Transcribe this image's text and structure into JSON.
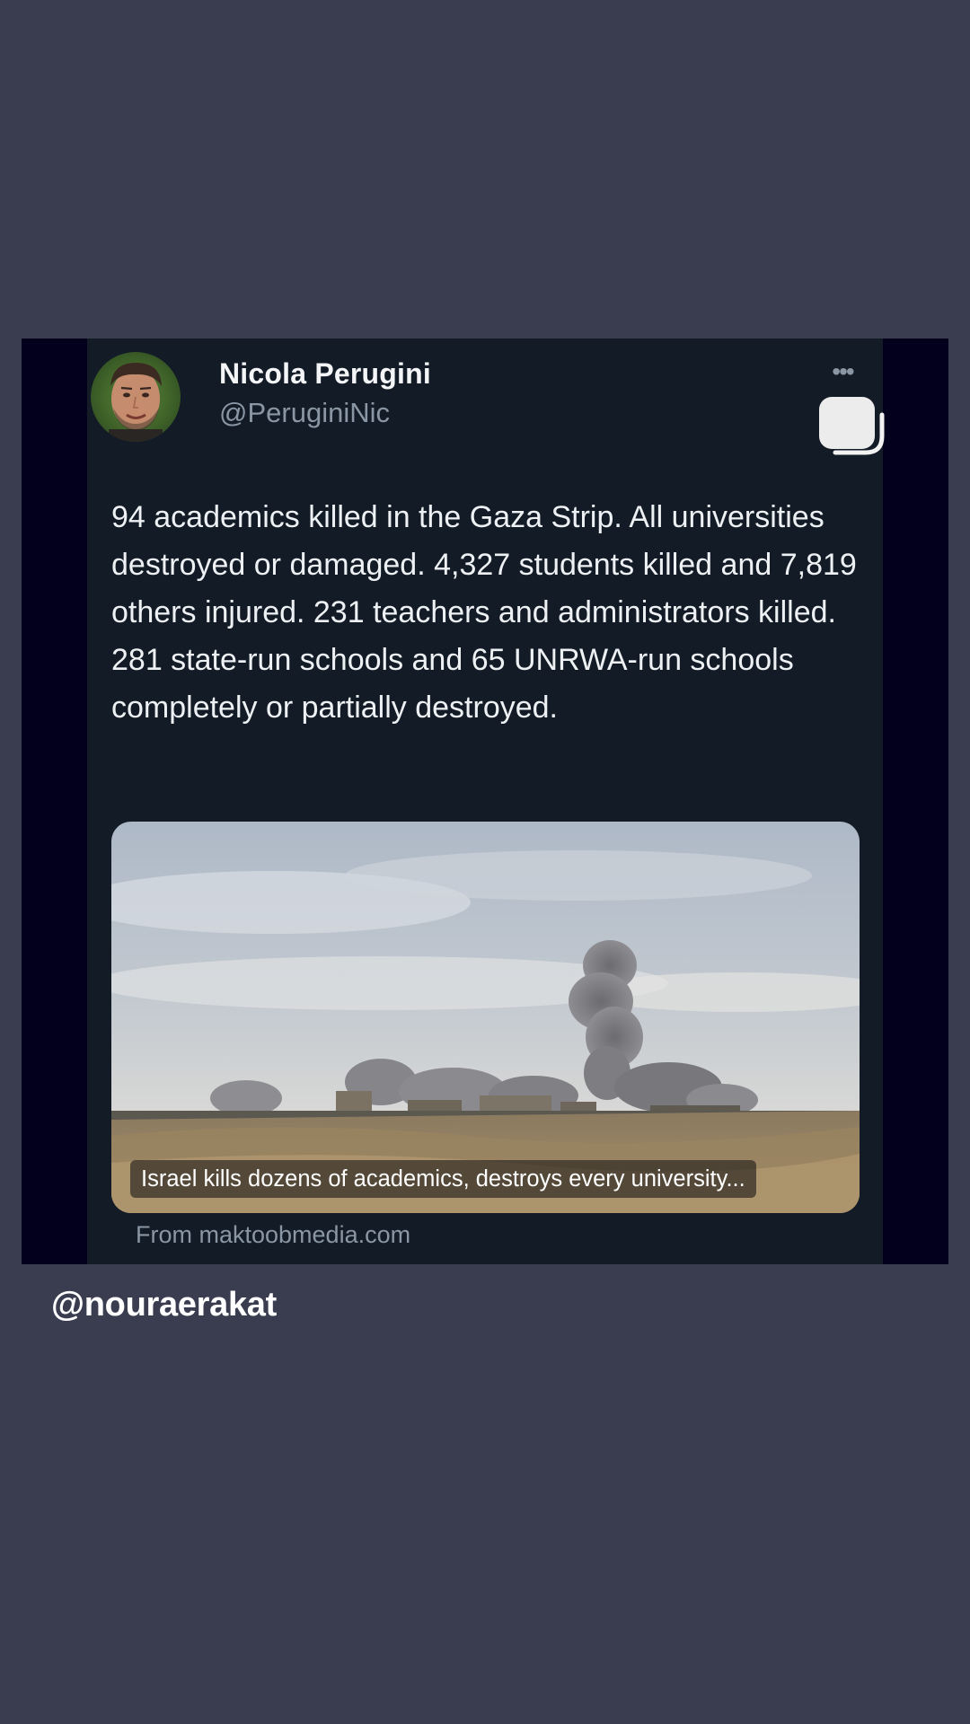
{
  "tweet": {
    "author_name": "Nicola Perugini",
    "author_handle": "@PeruginiNic",
    "more_icon": "more-dots-icon",
    "copy_icon": "copy-icon",
    "text": "94 academics killed in the Gaza Strip. All universities destroyed or damaged. 4,327 students killed and 7,819 others injured. 231 teachers and administrators killed. 281 state-run schools and 65 UNRWA-run schools completely or partially destroyed.",
    "link_card": {
      "headline": "Israel kills dozens of academics, destroys every university...",
      "source": "From maktoobmedia.com"
    }
  },
  "overlay": {
    "watermark": "@nouraerakat"
  },
  "colors": {
    "page_background": "#3a3d50",
    "card_background": "#131b26",
    "side_band": "#02001c",
    "primary_text": "#eef1f4",
    "secondary_text": "#8a96a3"
  }
}
